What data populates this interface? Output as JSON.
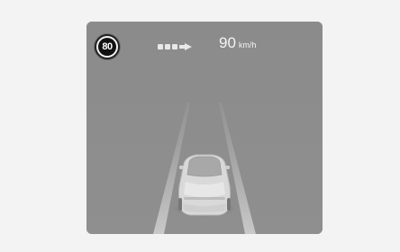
{
  "cluster": {
    "speed_limit": "80",
    "current_speed": "90",
    "speed_unit": "km/h",
    "icons": [
      "speed-limit-sign",
      "lane-keeping-icon",
      "ego-vehicle"
    ]
  },
  "colors": {
    "page_background": "#f3f3f3",
    "display_background": "#8e8e8e",
    "text": "#f4f4f4"
  }
}
